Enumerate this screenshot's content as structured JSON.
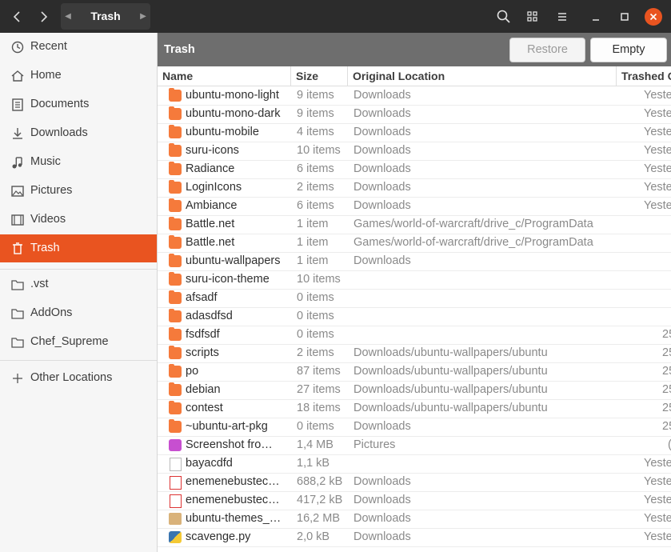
{
  "header": {
    "path_label": "Trash"
  },
  "sidebar": {
    "places": [
      {
        "label": "Recent",
        "icon": "clock-icon"
      },
      {
        "label": "Home",
        "icon": "home-icon"
      },
      {
        "label": "Documents",
        "icon": "documents-icon"
      },
      {
        "label": "Downloads",
        "icon": "downloads-icon"
      },
      {
        "label": "Music",
        "icon": "music-icon"
      },
      {
        "label": "Pictures",
        "icon": "pictures-icon"
      },
      {
        "label": "Videos",
        "icon": "videos-icon"
      },
      {
        "label": "Trash",
        "icon": "trash-icon",
        "active": true
      }
    ],
    "bookmarks": [
      {
        "label": ".vst",
        "icon": "folder-icon"
      },
      {
        "label": "AddOns",
        "icon": "folder-icon"
      },
      {
        "label": "Chef_Supreme",
        "icon": "folder-icon"
      }
    ],
    "other_locations": "Other Locations"
  },
  "actionbar": {
    "title": "Trash",
    "restore_label": "Restore",
    "empty_label": "Empty"
  },
  "columns": {
    "name": "Name",
    "size": "Size",
    "location": "Original Location",
    "trashed": "Trashed O"
  },
  "files": [
    {
      "name": "ubuntu-mono-light",
      "size": "9 items",
      "location": "Downloads",
      "trashed": "Yeste",
      "type": "folder"
    },
    {
      "name": "ubuntu-mono-dark",
      "size": "9 items",
      "location": "Downloads",
      "trashed": "Yeste",
      "type": "folder"
    },
    {
      "name": "ubuntu-mobile",
      "size": "4 items",
      "location": "Downloads",
      "trashed": "Yeste",
      "type": "folder"
    },
    {
      "name": "suru-icons",
      "size": "10 items",
      "location": "Downloads",
      "trashed": "Yeste",
      "type": "folder"
    },
    {
      "name": "Radiance",
      "size": "6 items",
      "location": "Downloads",
      "trashed": "Yeste",
      "type": "folder"
    },
    {
      "name": "LoginIcons",
      "size": "2 items",
      "location": "Downloads",
      "trashed": "Yeste",
      "type": "folder"
    },
    {
      "name": "Ambiance",
      "size": "6 items",
      "location": "Downloads",
      "trashed": "Yeste",
      "type": "folder"
    },
    {
      "name": "Battle.net",
      "size": "1 item",
      "location": "Games/world-of-warcraft/drive_c/ProgramData",
      "trashed": "",
      "type": "folder"
    },
    {
      "name": "Battle.net",
      "size": "1 item",
      "location": "Games/world-of-warcraft/drive_c/ProgramData",
      "trashed": "",
      "type": "folder"
    },
    {
      "name": "ubuntu-wallpapers",
      "size": "1 item",
      "location": "Downloads",
      "trashed": "",
      "type": "folder"
    },
    {
      "name": "suru-icon-theme",
      "size": "10 items",
      "location": "",
      "trashed": "",
      "type": "folder"
    },
    {
      "name": "afsadf",
      "size": "0 items",
      "location": "",
      "trashed": "",
      "type": "folder"
    },
    {
      "name": "adasdfsd",
      "size": "0 items",
      "location": "",
      "trashed": "",
      "type": "folder"
    },
    {
      "name": "fsdfsdf",
      "size": "0 items",
      "location": "",
      "trashed": "25",
      "type": "folder"
    },
    {
      "name": "scripts",
      "size": "2 items",
      "location": "Downloads/ubuntu-wallpapers/ubuntu",
      "trashed": "25",
      "type": "folder"
    },
    {
      "name": "po",
      "size": "87 items",
      "location": "Downloads/ubuntu-wallpapers/ubuntu",
      "trashed": "25",
      "type": "folder"
    },
    {
      "name": "debian",
      "size": "27 items",
      "location": "Downloads/ubuntu-wallpapers/ubuntu",
      "trashed": "25",
      "type": "folder"
    },
    {
      "name": "contest",
      "size": "18 items",
      "location": "Downloads/ubuntu-wallpapers/ubuntu",
      "trashed": "25",
      "type": "folder"
    },
    {
      "name": "~ubuntu-art-pkg",
      "size": "0 items",
      "location": "Downloads",
      "trashed": "25",
      "type": "folder"
    },
    {
      "name": "Screenshot fro…",
      "size": "1,4 MB",
      "location": "Pictures",
      "trashed": "(",
      "type": "image"
    },
    {
      "name": "bayacdfd",
      "size": "1,1 kB",
      "location": "",
      "trashed": "Yeste",
      "type": "text"
    },
    {
      "name": "enemenebustec…",
      "size": "688,2 kB",
      "location": "Downloads",
      "trashed": "Yeste",
      "type": "pdf"
    },
    {
      "name": "enemenebustec…",
      "size": "417,2 kB",
      "location": "Downloads",
      "trashed": "Yeste",
      "type": "pdf"
    },
    {
      "name": "ubuntu-themes_…",
      "size": "16,2 MB",
      "location": "Downloads",
      "trashed": "Yeste",
      "type": "archive"
    },
    {
      "name": "scavenge.py",
      "size": "2,0 kB",
      "location": "Downloads",
      "trashed": "Yeste",
      "type": "python"
    }
  ]
}
